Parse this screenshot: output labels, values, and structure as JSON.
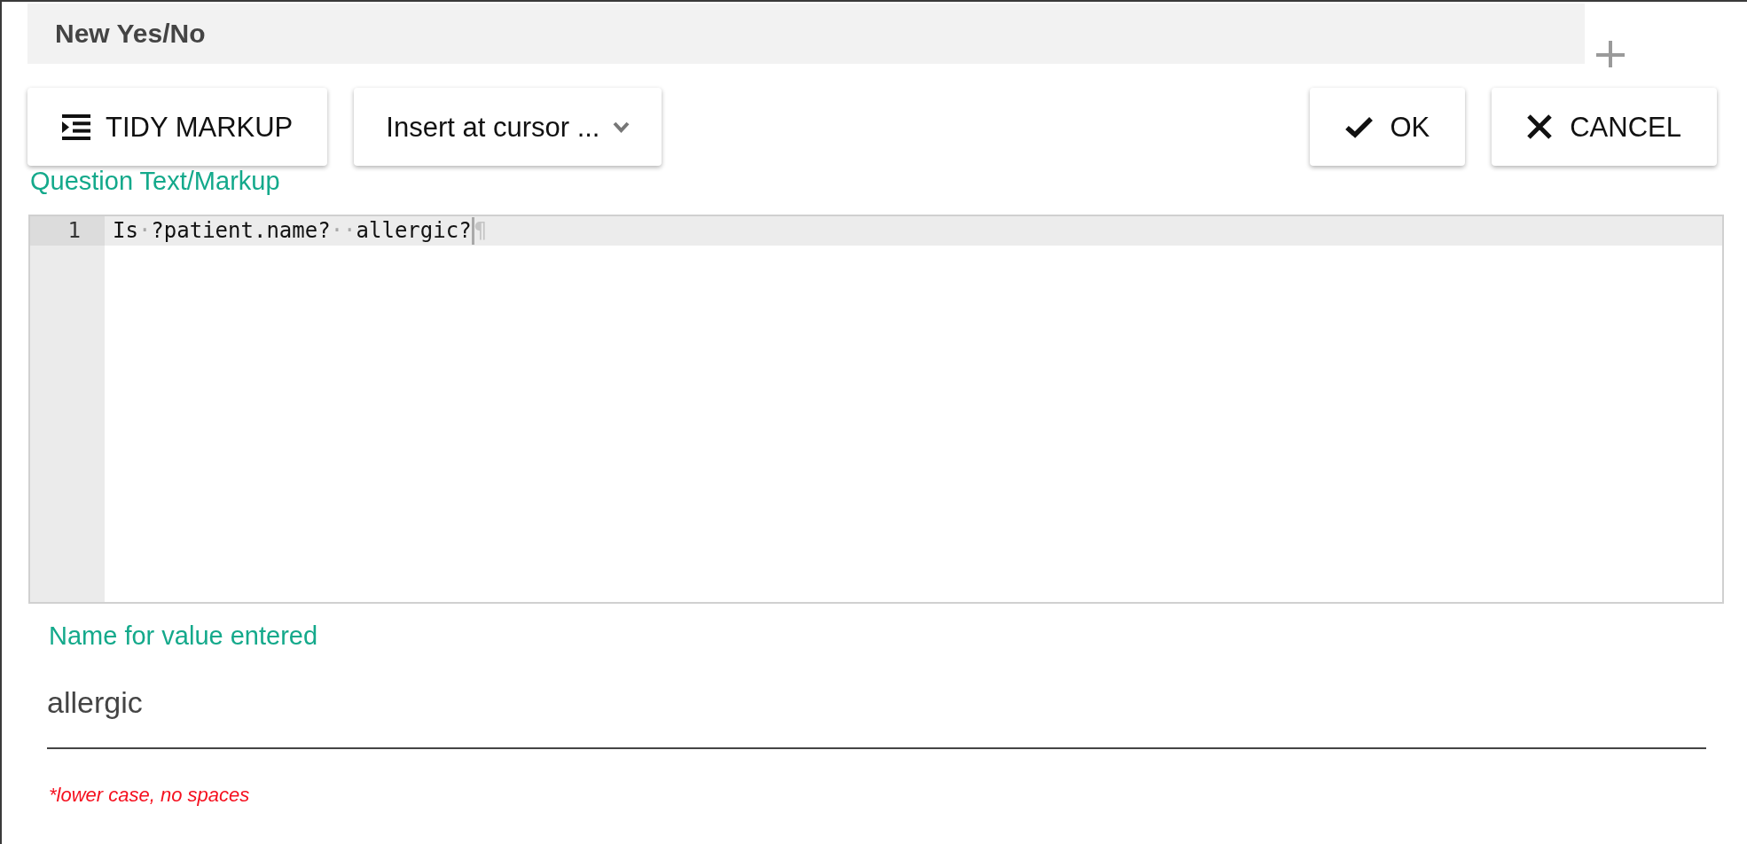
{
  "dialog": {
    "title": "New Yes/No"
  },
  "tools": [
    {
      "kind": "format",
      "label": "TIDY MARKUP"
    },
    {
      "kind": "menu",
      "label": "Insert at cursor ..."
    }
  ],
  "actions": [
    {
      "kind": "confirm",
      "label": "OK"
    },
    {
      "kind": "cancel",
      "label": "CANCEL"
    }
  ],
  "question_field": {
    "label": "Question Text/Markup",
    "lines": [
      {
        "number": "1",
        "text": "Is·?patient.name?··allergic?",
        "active": true,
        "end_marker": "¶"
      }
    ]
  },
  "name_field": {
    "label": "Name for value entered",
    "value": "allergic",
    "hint": "*lower case, no spaces"
  }
}
